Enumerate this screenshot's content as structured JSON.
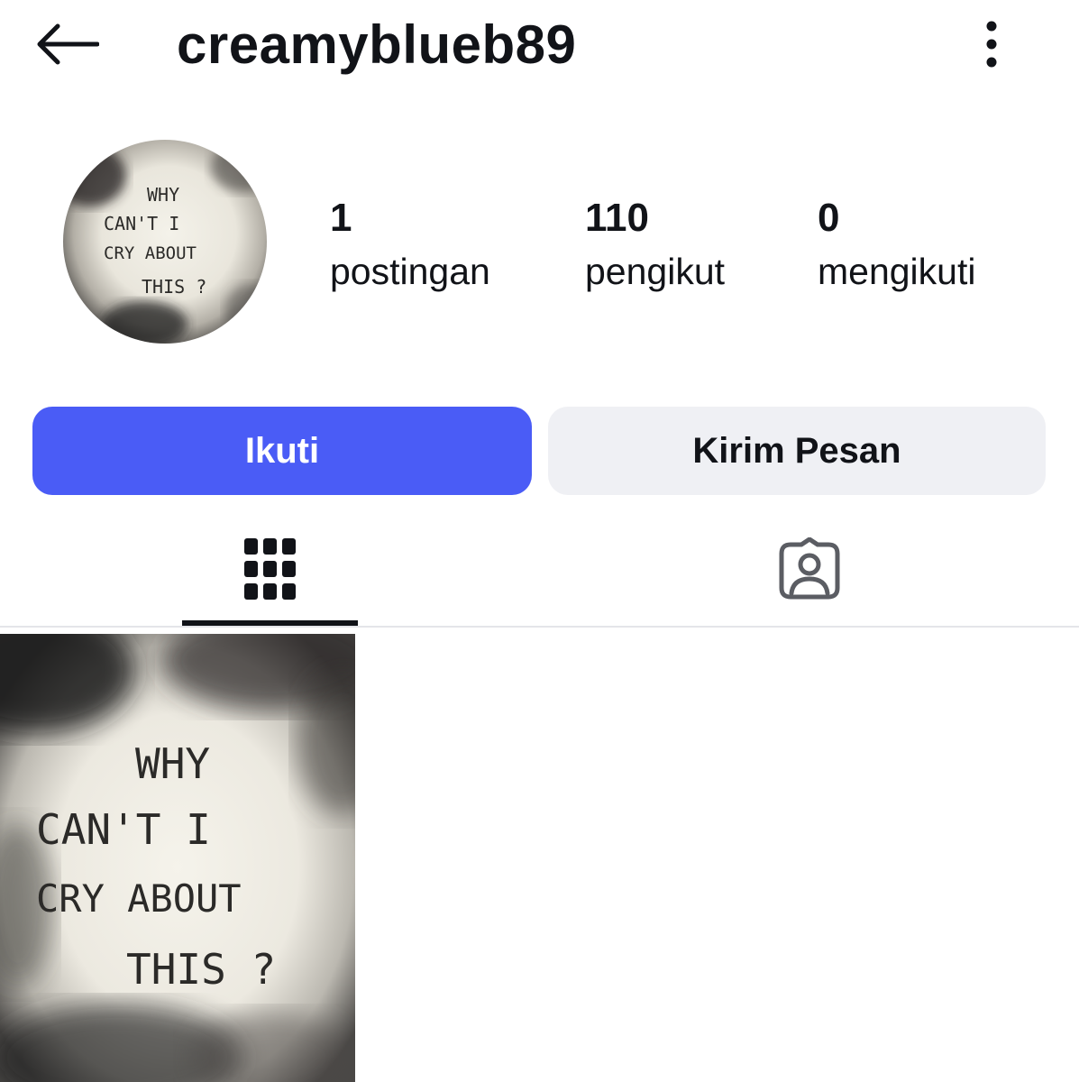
{
  "header": {
    "username": "creamyblueb89",
    "back_icon": "arrow-left-icon",
    "more_icon": "more-vertical-icon"
  },
  "profile": {
    "avatar_text": [
      "WHY",
      "CAN'T I",
      "CRY ABOUT",
      "THIS ?"
    ],
    "stats": {
      "posts": {
        "count": "1",
        "label": "postingan"
      },
      "followers": {
        "count": "110",
        "label": "pengikut"
      },
      "following": {
        "count": "0",
        "label": "mengikuti"
      }
    }
  },
  "actions": {
    "follow_label": "Ikuti",
    "message_label": "Kirim Pesan"
  },
  "tabs": [
    {
      "name": "posts",
      "icon": "grid-icon",
      "active": true
    },
    {
      "name": "tagged",
      "icon": "tagged-user-icon",
      "active": false
    }
  ],
  "posts": [
    {
      "image_text": [
        "WHY",
        "CAN'T I",
        "CRY ABOUT",
        "THIS ?"
      ]
    }
  ],
  "colors": {
    "primary": "#4a5cf6",
    "secondary_button": "#eff0f4",
    "text": "#111318",
    "divider": "#e4e5e9"
  }
}
